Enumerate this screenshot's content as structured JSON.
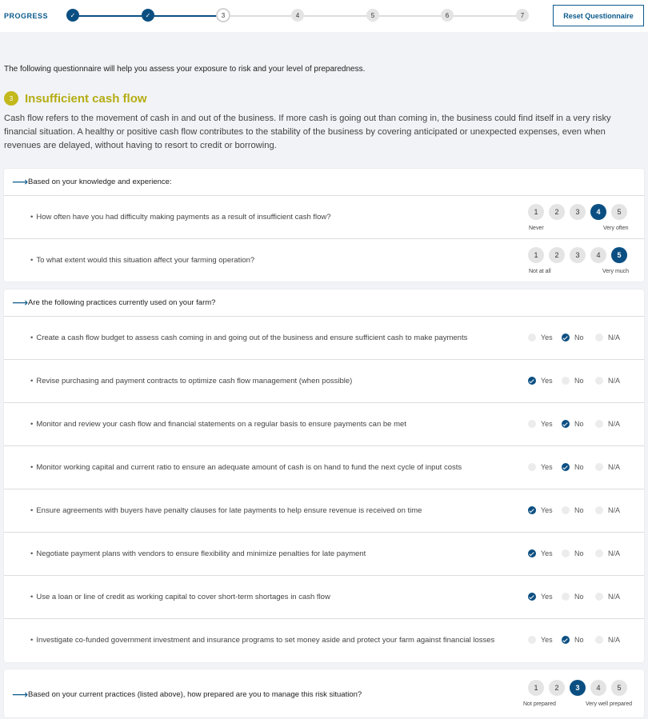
{
  "progress": {
    "label": "PROGRESS",
    "steps": [
      "1",
      "2",
      "3",
      "4",
      "5",
      "6",
      "7"
    ],
    "completed": 2,
    "current": 3,
    "reset_label": "Reset Questionnaire"
  },
  "intro": "The following questionnaire will help you assess your exposure to risk and your level of preparedness.",
  "section": {
    "number": "3",
    "title": "Insufficient cash flow",
    "description": "Cash flow refers to the movement of cash in and out of the business. If more cash is going out than coming in, the business could find itself in a very risky financial situation. A healthy or positive cash flow contributes to the stability of the business by covering anticipated or unexpected expenses, even when revenues are delayed, without having to resort to credit or borrowing."
  },
  "knowledge": {
    "heading": "Based on your knowledge and experience:",
    "items": [
      {
        "text": "How often have you had difficulty making payments as a result of insufficient cash flow?",
        "options": [
          "1",
          "2",
          "3",
          "4",
          "5"
        ],
        "selected": "4",
        "low": "Never",
        "high": "Very often"
      },
      {
        "text": "To what extent would this situation affect your farming operation?",
        "options": [
          "1",
          "2",
          "3",
          "4",
          "5"
        ],
        "selected": "5",
        "low": "Not at all",
        "high": "Very much"
      }
    ]
  },
  "practices": {
    "heading": "Are the following practices currently used on your farm?",
    "option_labels": [
      "Yes",
      "No",
      "N/A"
    ],
    "items": [
      {
        "text": "Create a cash flow budget to assess cash coming in and going out of the business and ensure sufficient cash to make payments",
        "selected": "No"
      },
      {
        "text": "Revise purchasing and payment contracts to optimize cash flow management (when possible)",
        "selected": "Yes"
      },
      {
        "text": "Monitor and review your cash flow and financial statements on a regular basis to ensure payments can be met",
        "selected": "No"
      },
      {
        "text": "Monitor working capital and current ratio to ensure an adequate amount of cash is on hand to fund the next cycle of input costs",
        "selected": "No"
      },
      {
        "text": "Ensure agreements with buyers have penalty clauses for late payments to help ensure revenue is received on time",
        "selected": "Yes"
      },
      {
        "text": "Negotiate payment plans with vendors to ensure flexibility and minimize penalties for late payment",
        "selected": "Yes"
      },
      {
        "text": "Use a loan or line of credit as working capital to cover short-term shortages in cash flow",
        "selected": "Yes"
      },
      {
        "text": "Investigate co-funded government investment and insurance programs to set money aside and protect your farm against financial losses",
        "selected": "No"
      }
    ]
  },
  "preparedness": {
    "heading": "Based on your current practices (listed above), how prepared are you to manage this risk situation?",
    "options": [
      "1",
      "2",
      "3",
      "4",
      "5"
    ],
    "selected": "3",
    "low": "Not prepared",
    "high": "Very well prepared"
  },
  "colors": {
    "accent": "#0b4f82",
    "section": "#c3b81c",
    "background": "#f1f3f6"
  }
}
